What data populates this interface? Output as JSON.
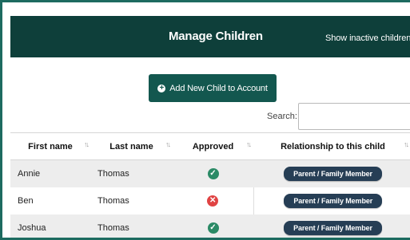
{
  "header": {
    "title": "Manage Children",
    "show_inactive": "Show inactive children"
  },
  "add_button": {
    "label": "Add New Child to Account"
  },
  "search": {
    "label": "Search:",
    "value": ""
  },
  "table": {
    "columns": [
      "First name",
      "Last name",
      "Approved",
      "Relationship to this child"
    ],
    "rows": [
      {
        "first": "Annie",
        "last": "Thomas",
        "approved": true,
        "relationship": "Parent / Family Member"
      },
      {
        "first": "Ben",
        "last": "Thomas",
        "approved": false,
        "relationship": "Parent / Family Member"
      },
      {
        "first": "Joshua",
        "last": "Thomas",
        "approved": true,
        "relationship": "Parent / Family Member"
      }
    ]
  },
  "colors": {
    "header_bg": "#0e3f3a",
    "button_bg": "#13574f",
    "approved": "#2b8a66",
    "not_approved": "#e04343",
    "pill_bg": "#263e55"
  },
  "icons": {
    "sort": "sort-icon",
    "approved": "check-circle-icon",
    "not_approved": "x-circle-icon",
    "add": "plus-circle-icon"
  }
}
